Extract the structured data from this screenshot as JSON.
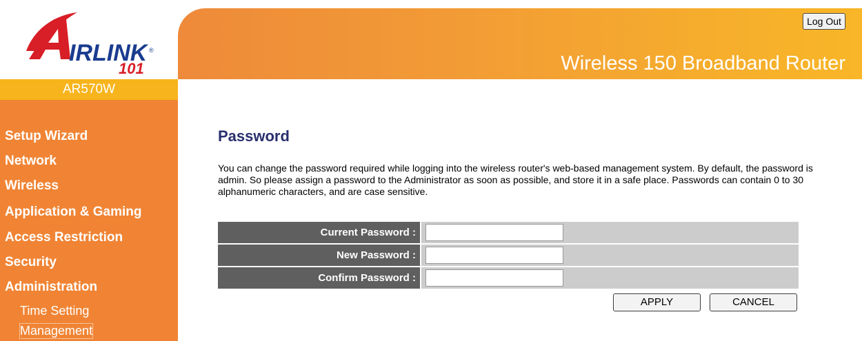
{
  "brand": {
    "logo_text": "AIRLINK 101",
    "model": "AR570W",
    "product_title": "Wireless 150 Broadband Router",
    "colors": {
      "orange": "#f08434",
      "yellow": "#f7b41c",
      "logo_red": "#d81e26",
      "logo_blue": "#1a3c8f"
    }
  },
  "header": {
    "logout_label": "Log Out"
  },
  "sidebar": {
    "items": [
      {
        "label": "Setup Wizard"
      },
      {
        "label": "Network"
      },
      {
        "label": "Wireless"
      },
      {
        "label": "Application & Gaming"
      },
      {
        "label": "Access Restriction"
      },
      {
        "label": "Security"
      },
      {
        "label": "Administration"
      }
    ],
    "sub_items": [
      {
        "label": "Time Setting"
      },
      {
        "label": "Management",
        "active": true
      }
    ]
  },
  "main": {
    "title": "Password",
    "description": "You can change the password required while logging into the wireless router's web-based management system. By default, the password is admin. So please assign a password to the Administrator as soon as possible, and store it in a safe place. Passwords can contain 0 to 30 alphanumeric characters, and are case sensitive.",
    "fields": [
      {
        "label": "Current Password :",
        "value": ""
      },
      {
        "label": "New Password :",
        "value": ""
      },
      {
        "label": "Confirm Password :",
        "value": ""
      }
    ],
    "apply_label": "APPLY",
    "cancel_label": "CANCEL"
  }
}
